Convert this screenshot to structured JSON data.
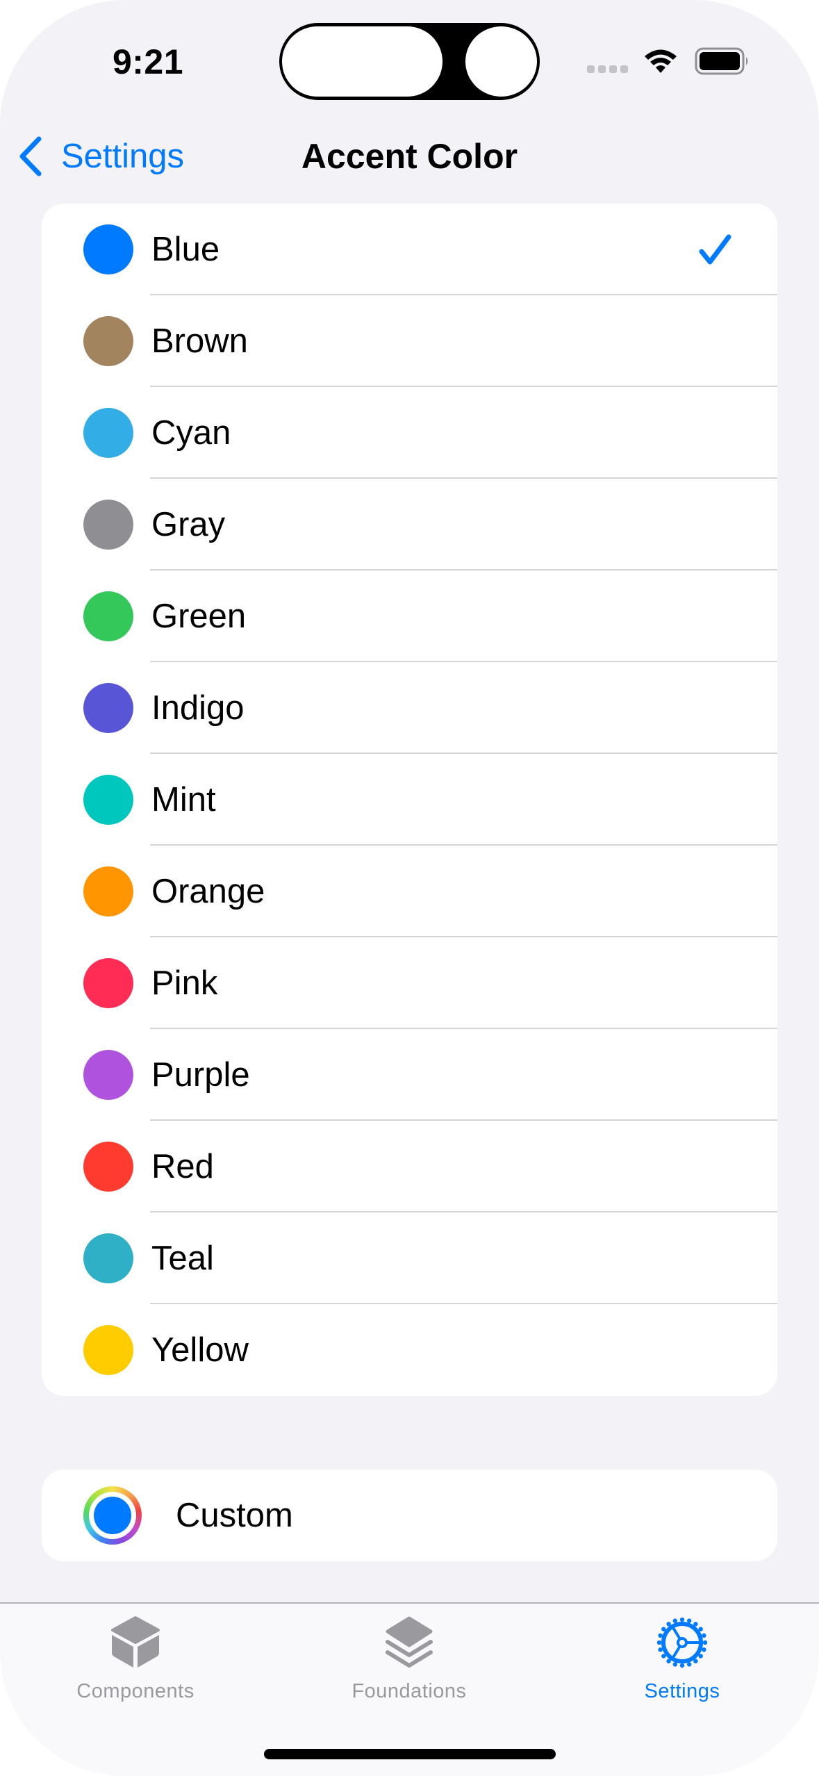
{
  "status_bar": {
    "time": "9:21",
    "signal_icon": "cellular-signal-icon",
    "wifi_icon": "wifi-icon",
    "battery_icon": "battery-icon"
  },
  "nav": {
    "back_label": "Settings",
    "back_icon": "chevron-left-icon",
    "title": "Accent Color"
  },
  "accent_colors": {
    "selected": "Blue",
    "items": [
      {
        "label": "Blue",
        "color": "#007AFF",
        "selected": true
      },
      {
        "label": "Brown",
        "color": "#A2845E",
        "selected": false
      },
      {
        "label": "Cyan",
        "color": "#32ADE6",
        "selected": false
      },
      {
        "label": "Gray",
        "color": "#8E8E93",
        "selected": false
      },
      {
        "label": "Green",
        "color": "#34C759",
        "selected": false
      },
      {
        "label": "Indigo",
        "color": "#5856D6",
        "selected": false
      },
      {
        "label": "Mint",
        "color": "#00C7BE",
        "selected": false
      },
      {
        "label": "Orange",
        "color": "#FF9500",
        "selected": false
      },
      {
        "label": "Pink",
        "color": "#FF2D55",
        "selected": false
      },
      {
        "label": "Purple",
        "color": "#AF52DE",
        "selected": false
      },
      {
        "label": "Red",
        "color": "#FF3B30",
        "selected": false
      },
      {
        "label": "Teal",
        "color": "#30B0C7",
        "selected": false
      },
      {
        "label": "Yellow",
        "color": "#FFCC00",
        "selected": false
      }
    ]
  },
  "custom": {
    "label": "Custom",
    "color": "#007AFF",
    "icon": "color-wheel-icon"
  },
  "tab_bar": {
    "active_color": "#007AFF",
    "inactive_color": "#9A9A9E",
    "tabs": [
      {
        "label": "Components",
        "icon": "cube-icon",
        "active": false
      },
      {
        "label": "Foundations",
        "icon": "layers-icon",
        "active": false
      },
      {
        "label": "Settings",
        "icon": "gear-icon",
        "active": true
      }
    ]
  }
}
